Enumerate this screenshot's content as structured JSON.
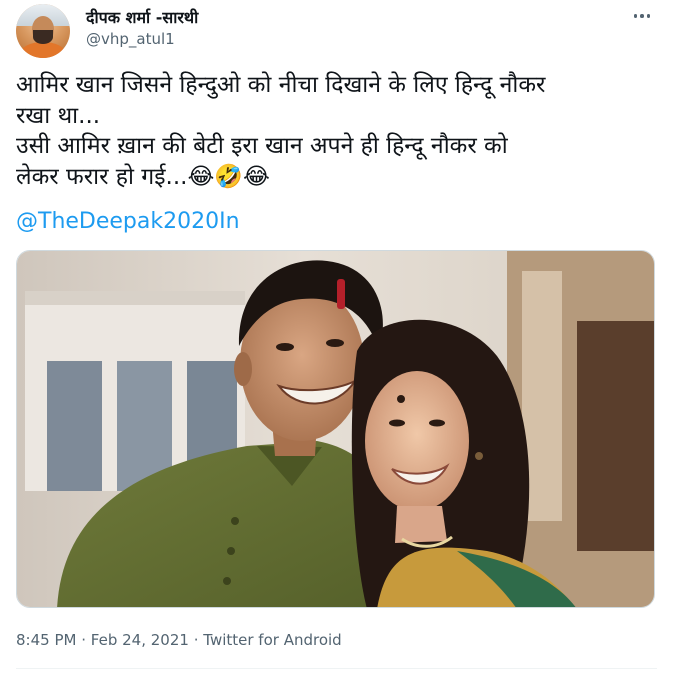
{
  "author": {
    "display_name": "दीपक शर्मा -सारथी",
    "handle": "@vhp_atul1"
  },
  "tweet": {
    "lines": [
      "आमिर खान जिसने हिन्दुओ को नीचा दिखाने के लिए हिन्दू नौकर",
      "रखा था...",
      "उसी आमिर ख़ान की बेटी इरा खान अपने ही हिन्दू नौकर को",
      "लेकर फरार हो गई...😂🤣😂"
    ],
    "mention": "@TheDeepak2020In"
  },
  "meta": {
    "time": "8:45 PM",
    "separator": "·",
    "date": "Feb 24, 2021",
    "source": "Twitter for Android"
  },
  "colors": {
    "text": "#0f1419",
    "secondary": "#536471",
    "link": "#1d9bf0",
    "divider": "#eff3f4"
  },
  "icons": {
    "more": "more-horizontal-icon"
  }
}
